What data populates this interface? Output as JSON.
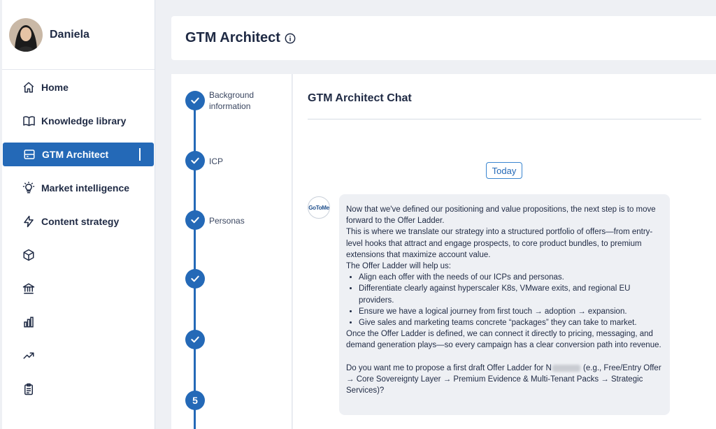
{
  "profile": {
    "name": "Daniela"
  },
  "nav": {
    "items": [
      {
        "label": "Home",
        "icon": "home-icon"
      },
      {
        "label": "Knowledge library",
        "icon": "book-icon"
      },
      {
        "label": "GTM Architect",
        "icon": "server-icon",
        "active": true
      },
      {
        "label": "Market intelligence",
        "icon": "lightbulb-icon"
      },
      {
        "label": "Content strategy",
        "icon": "lightning-icon"
      }
    ],
    "icon_only": [
      "cube-icon",
      "bank-icon",
      "bar-chart-icon",
      "trending-up-icon",
      "clipboard-icon"
    ]
  },
  "header": {
    "title": "GTM Architect"
  },
  "steps": [
    {
      "label": "Background information",
      "state": "done"
    },
    {
      "label": "ICP",
      "state": "done"
    },
    {
      "label": "Personas",
      "state": "done"
    },
    {
      "label": "",
      "state": "done"
    },
    {
      "label": "",
      "state": "done"
    },
    {
      "label": "",
      "number": "5",
      "state": "current"
    }
  ],
  "chat": {
    "title": "GTM Architect Chat",
    "date_divider": "Today",
    "bot_avatar_text": "GoToMe",
    "message": {
      "p1": "Now that we've defined our positioning and value propositions, the next step is to move forward to the Offer Ladder.",
      "p2": "This is where we translate our strategy into a structured portfolio of offers—from entry-level hooks that attract and engage prospects, to core product bundles, to premium extensions that maximize account value.",
      "p3": "The Offer Ladder will help us:",
      "bullets": [
        "Align each offer with the needs of our ICPs and personas.",
        "Differentiate clearly against hyperscaler K8s, VMware exits, and regional EU providers.",
        "Ensure we have a logical journey from first touch → adoption → expansion.",
        "Give sales and marketing teams concrete “packages” they can take to market."
      ],
      "p4": "Once the Offer Ladder is defined, we can connect it directly to pricing, messaging, and demand generation plays—so every campaign has a clear conversion path into revenue.",
      "q_before": "Do you want me to propose a first draft Offer Ladder for N",
      "q_after": " (e.g., Free/Entry Offer → Core Sovereignty Layer → Premium Evidence & Multi-Tenant Packs → Strategic Services)?"
    }
  },
  "colors": {
    "accent": "#2469b7",
    "background": "#eef0f4",
    "text": "#1f2a44"
  }
}
